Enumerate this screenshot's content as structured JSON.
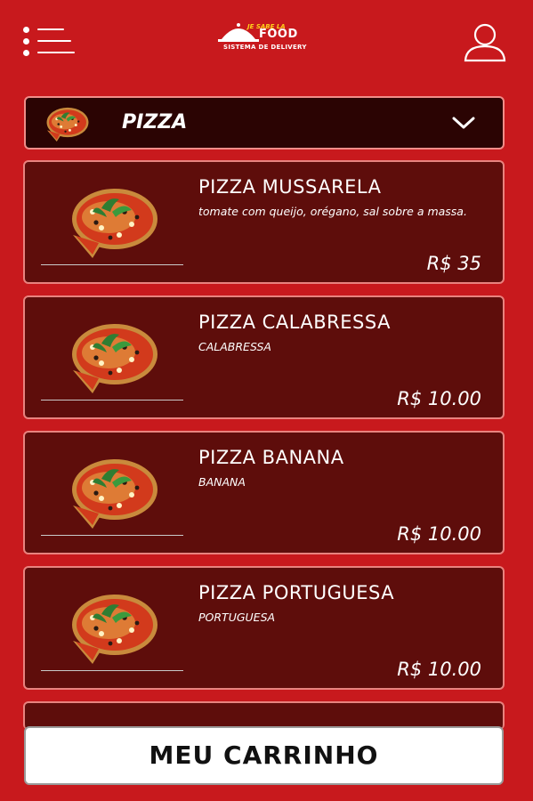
{
  "header": {
    "menu_icon": "hamburger-menu-icon",
    "logo": {
      "text_small": "JE SABE LA",
      "text_main": "FOOD",
      "tagline": "SISTEMA DE DELIVERY"
    },
    "user_icon": "user-profile-icon"
  },
  "category": {
    "label": "PIZZA",
    "dropdown_icon": "chevron-down-icon"
  },
  "products": [
    {
      "name": "PIZZA MUSSARELA",
      "description": "tomate com  queijo, orégano, sal sobre a massa.",
      "price": "R$ 35"
    },
    {
      "name": "PIZZA CALABRESSA",
      "description": "CALABRESSA",
      "price": "R$ 10.00"
    },
    {
      "name": "PIZZA BANANA",
      "description": "BANANA",
      "price": "R$ 10.00"
    },
    {
      "name": "PIZZA PORTUGUESA",
      "description": "PORTUGUESA",
      "price": "R$ 10.00"
    }
  ],
  "cart_button": {
    "label": "MEU CARRINHO"
  },
  "colors": {
    "background": "#c8191d",
    "card": "#5e0d0b",
    "card_border": "#e8837f",
    "category_bar": "#2b0403",
    "logo_accent": "#ffd21a"
  }
}
